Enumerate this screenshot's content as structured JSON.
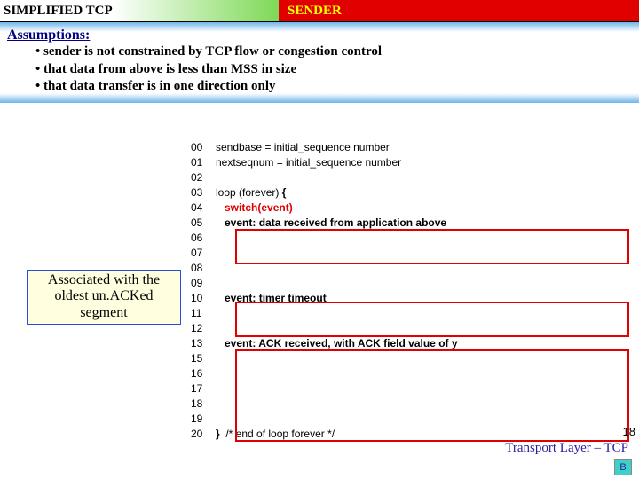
{
  "header": {
    "left": "SIMPLIFIED TCP",
    "right": "SENDER"
  },
  "assumptions": {
    "title": "Assumptions:",
    "items": [
      "• sender is not constrained by TCP flow or congestion control",
      "• that data from above is less than MSS in size",
      "• that data transfer is in one direction only"
    ]
  },
  "code": {
    "l00n": "00",
    "l00t": "sendbase = initial_sequence number",
    "l01n": "01",
    "l01t": "nextseqnum = initial_sequence number",
    "l02n": "02",
    "l03n": "03",
    "l03t": "loop (forever) ",
    "l03brace": "{",
    "l04n": "04",
    "l04sw": "   switch(event)",
    "l05n": "05",
    "l05ev": "   event:",
    "l05t": " data received from application above",
    "l06n": "06",
    "l07n": "07",
    "l08n": "08",
    "l09n": "09",
    "l10n": "10",
    "l10ev": "   event:",
    "l10t": " timer timeout",
    "l11n": "11",
    "l12n": "12",
    "l13n": "13",
    "l13ev": "   event:",
    "l13t": " ACK received, with ACK field value of y",
    "l15n": "15",
    "l16n": "16",
    "l17n": "17",
    "l18n": "18",
    "l19n": "19",
    "l20n": "20",
    "l20brace": "}",
    "l20t": "  /* end of loop forever */"
  },
  "assoc": {
    "l1": "Associated with the",
    "l2": "oldest un.ACKed",
    "l3": "segment"
  },
  "footer": "Transport Layer – TCP",
  "pagenum": "18",
  "badge": "B"
}
